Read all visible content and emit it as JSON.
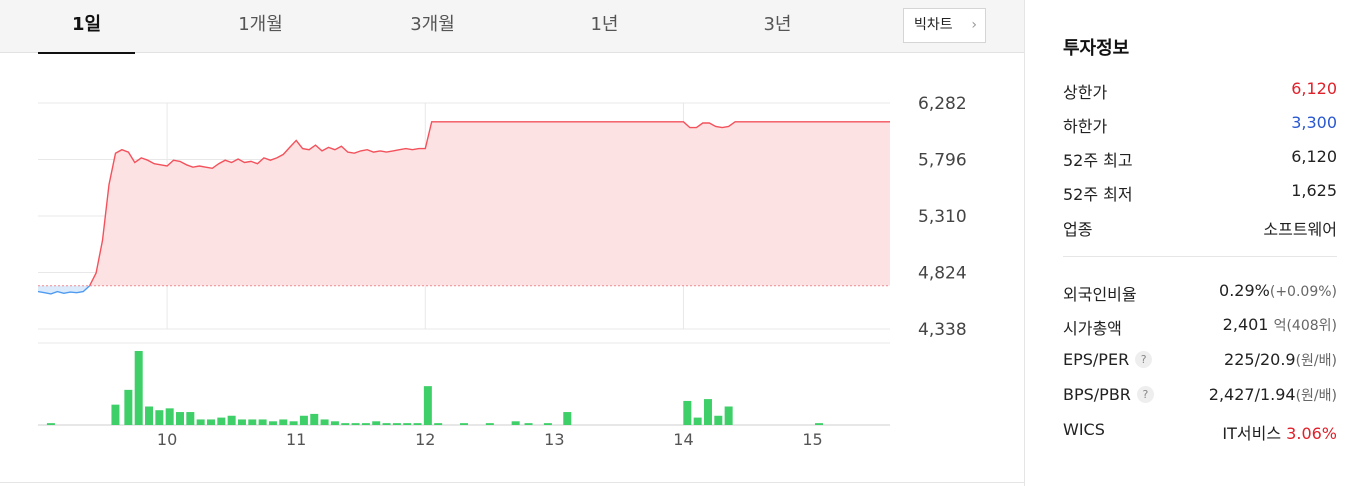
{
  "tabs": [
    {
      "label": "1일",
      "active": true
    },
    {
      "label": "1개월",
      "active": false
    },
    {
      "label": "3개월",
      "active": false
    },
    {
      "label": "1년",
      "active": false
    },
    {
      "label": "3년",
      "active": false
    }
  ],
  "bigchart_label": "빅차트",
  "chevron_glyph": "›",
  "info": {
    "title": "투자정보",
    "upper_limit_label": "상한가",
    "upper_limit": "6,120",
    "lower_limit_label": "하한가",
    "lower_limit": "3,300",
    "high52_label": "52주 최고",
    "high52": "6,120",
    "low52_label": "52주 최저",
    "low52": "1,625",
    "sector_label": "업종",
    "sector": "소프트웨어",
    "foreign_label": "외국인비율",
    "foreign": "0.29%",
    "foreign_change": "(+0.09%)",
    "mcap_label": "시가총액",
    "mcap": "2,401",
    "mcap_unit": "억",
    "mcap_rank": "(408위)",
    "eps_label": "EPS/PER",
    "eps": "225/20.9",
    "eps_unit": "(원/배)",
    "bps_label": "BPS/PBR",
    "bps": "2,427/1.94",
    "bps_unit": "(원/배)",
    "wics_label": "WICS",
    "wics": "IT서비스",
    "wics_change": "3.06%",
    "help_glyph": "?"
  },
  "chart_data": {
    "type": "area",
    "y_ticks": [
      "6,282",
      "5,796",
      "5,310",
      "4,824",
      "4,338"
    ],
    "ylim": [
      4338,
      6282
    ],
    "x_ticks": [
      "10",
      "11",
      "12",
      "13",
      "14",
      "15"
    ],
    "x_tick_positions": [
      10,
      11,
      12,
      13,
      14,
      15
    ],
    "xlim": [
      9,
      15.6
    ],
    "baseline": 4710,
    "colors": {
      "up_line": "#f3525c",
      "up_fill": "#fde2e3",
      "down_line": "#4f9bf0",
      "down_fill": "#dcebfb",
      "volume": "#3ecf68",
      "grid": "#e8e8e8",
      "baseline": "#f08a90"
    },
    "price_x": [
      9.0,
      9.05,
      9.1,
      9.15,
      9.2,
      9.25,
      9.3,
      9.35,
      9.4,
      9.45,
      9.5,
      9.55,
      9.6,
      9.65,
      9.7,
      9.75,
      9.8,
      9.85,
      9.9,
      9.95,
      10.0,
      10.05,
      10.1,
      10.15,
      10.2,
      10.25,
      10.3,
      10.35,
      10.4,
      10.45,
      10.5,
      10.55,
      10.6,
      10.65,
      10.7,
      10.75,
      10.8,
      10.85,
      10.9,
      10.95,
      11.0,
      11.05,
      11.1,
      11.15,
      11.2,
      11.25,
      11.3,
      11.35,
      11.4,
      11.45,
      11.5,
      11.55,
      11.6,
      11.65,
      11.7,
      11.75,
      11.8,
      11.85,
      11.9,
      11.95,
      12.0,
      12.05,
      12.1,
      12.2,
      12.4,
      12.6,
      12.8,
      13.0,
      13.2,
      13.4,
      13.6,
      13.8,
      14.0,
      14.05,
      14.1,
      14.15,
      14.2,
      14.25,
      14.3,
      14.35,
      14.4,
      14.45,
      14.5,
      14.7,
      14.9,
      15.1,
      15.3,
      15.6
    ],
    "price_y": [
      4660,
      4650,
      4640,
      4660,
      4645,
      4655,
      4650,
      4660,
      4710,
      4820,
      5100,
      5580,
      5850,
      5880,
      5860,
      5770,
      5810,
      5790,
      5760,
      5750,
      5740,
      5790,
      5780,
      5750,
      5730,
      5740,
      5730,
      5720,
      5760,
      5790,
      5770,
      5800,
      5770,
      5780,
      5760,
      5810,
      5790,
      5810,
      5840,
      5900,
      5960,
      5890,
      5880,
      5920,
      5870,
      5900,
      5880,
      5910,
      5860,
      5850,
      5870,
      5880,
      5860,
      5870,
      5860,
      5870,
      5880,
      5890,
      5880,
      5890,
      5890,
      6120,
      6120,
      6120,
      6120,
      6120,
      6120,
      6120,
      6120,
      6120,
      6120,
      6120,
      6120,
      6070,
      6070,
      6110,
      6110,
      6080,
      6070,
      6080,
      6120,
      6120,
      6120,
      6120,
      6120,
      6120,
      6120,
      6120
    ],
    "volume_x": [
      9.1,
      9.6,
      9.7,
      9.78,
      9.86,
      9.94,
      10.02,
      10.1,
      10.18,
      10.26,
      10.34,
      10.42,
      10.5,
      10.58,
      10.66,
      10.74,
      10.82,
      10.9,
      10.98,
      11.06,
      11.14,
      11.22,
      11.3,
      11.38,
      11.46,
      11.54,
      11.62,
      11.7,
      11.78,
      11.86,
      11.94,
      12.02,
      12.1,
      12.3,
      12.5,
      12.7,
      12.8,
      12.95,
      13.1,
      14.03,
      14.11,
      14.19,
      14.27,
      14.35,
      15.05
    ],
    "volume": [
      2,
      22,
      38,
      80,
      20,
      16,
      18,
      14,
      14,
      6,
      6,
      8,
      10,
      6,
      6,
      6,
      4,
      6,
      4,
      10,
      12,
      6,
      4,
      2,
      2,
      2,
      4,
      2,
      2,
      2,
      2,
      42,
      2,
      2,
      2,
      4,
      2,
      2,
      14,
      26,
      8,
      28,
      10,
      20,
      2
    ]
  }
}
